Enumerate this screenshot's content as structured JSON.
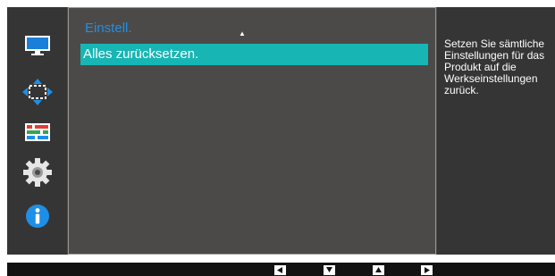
{
  "menu": {
    "title": "Einstell.",
    "scroll_indicator": "▲",
    "items": [
      {
        "label": "Alles zurücksetzen.",
        "selected": true
      }
    ]
  },
  "help": {
    "text": "Setzen Sie sämtliche\nEinstellungen für das\nProdukt auf die\nWerkseinstellungen\nzurück."
  },
  "sidebar": {
    "icons": [
      "monitor-icon",
      "size-position-icon",
      "picture-adjust-icon",
      "settings-gear-icon",
      "info-icon"
    ]
  },
  "navigation": {
    "buttons": [
      "left-arrow-icon",
      "down-arrow-icon",
      "up-arrow-icon",
      "right-arrow-icon"
    ]
  },
  "colors": {
    "accent": "#1e8fe6",
    "selection": "#17b6b4",
    "panel": "#4c4a48",
    "sidebar": "#353535"
  }
}
